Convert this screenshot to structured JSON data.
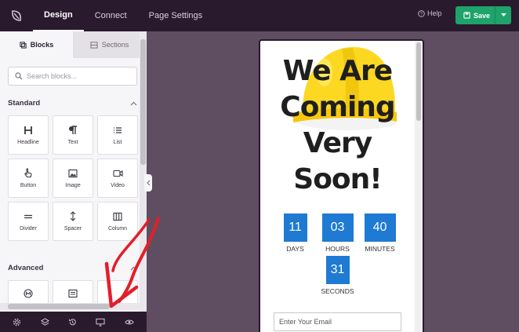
{
  "topbar": {
    "nav": [
      {
        "label": "Design",
        "active": true
      },
      {
        "label": "Connect",
        "active": false
      },
      {
        "label": "Page Settings",
        "active": false
      }
    ],
    "help_label": "Help",
    "save_label": "Save"
  },
  "sidebar": {
    "tabs": [
      {
        "label": "Blocks",
        "active": true
      },
      {
        "label": "Sections",
        "active": false
      }
    ],
    "search_placeholder": "Search blocks...",
    "standard_title": "Standard",
    "advanced_title": "Advanced",
    "standard_blocks": [
      {
        "label": "Headline",
        "icon": "headline-icon"
      },
      {
        "label": "Text",
        "icon": "paragraph-icon"
      },
      {
        "label": "List",
        "icon": "list-icon"
      },
      {
        "label": "Button",
        "icon": "pointer-icon"
      },
      {
        "label": "Image",
        "icon": "image-icon"
      },
      {
        "label": "Video",
        "icon": "video-icon"
      },
      {
        "label": "Divider",
        "icon": "divider-icon"
      },
      {
        "label": "Spacer",
        "icon": "spacer-icon"
      },
      {
        "label": "Column",
        "icon": "column-icon"
      }
    ]
  },
  "page": {
    "headline": "We Are Coming Very Soon!",
    "countdown": [
      {
        "value": "11",
        "unit": "DAYS"
      },
      {
        "value": "03",
        "unit": "HOURS"
      },
      {
        "value": "40",
        "unit": "MINUTES"
      },
      {
        "value": "31",
        "unit": "SECONDS"
      }
    ],
    "email_placeholder": "Enter Your Email"
  },
  "colors": {
    "topbar_bg": "#2a1a2e",
    "canvas_bg": "#5f4e62",
    "save_green": "#1ea36a",
    "countdown_blue": "#1f7ad3",
    "annotation_red": "#e41e2b"
  }
}
